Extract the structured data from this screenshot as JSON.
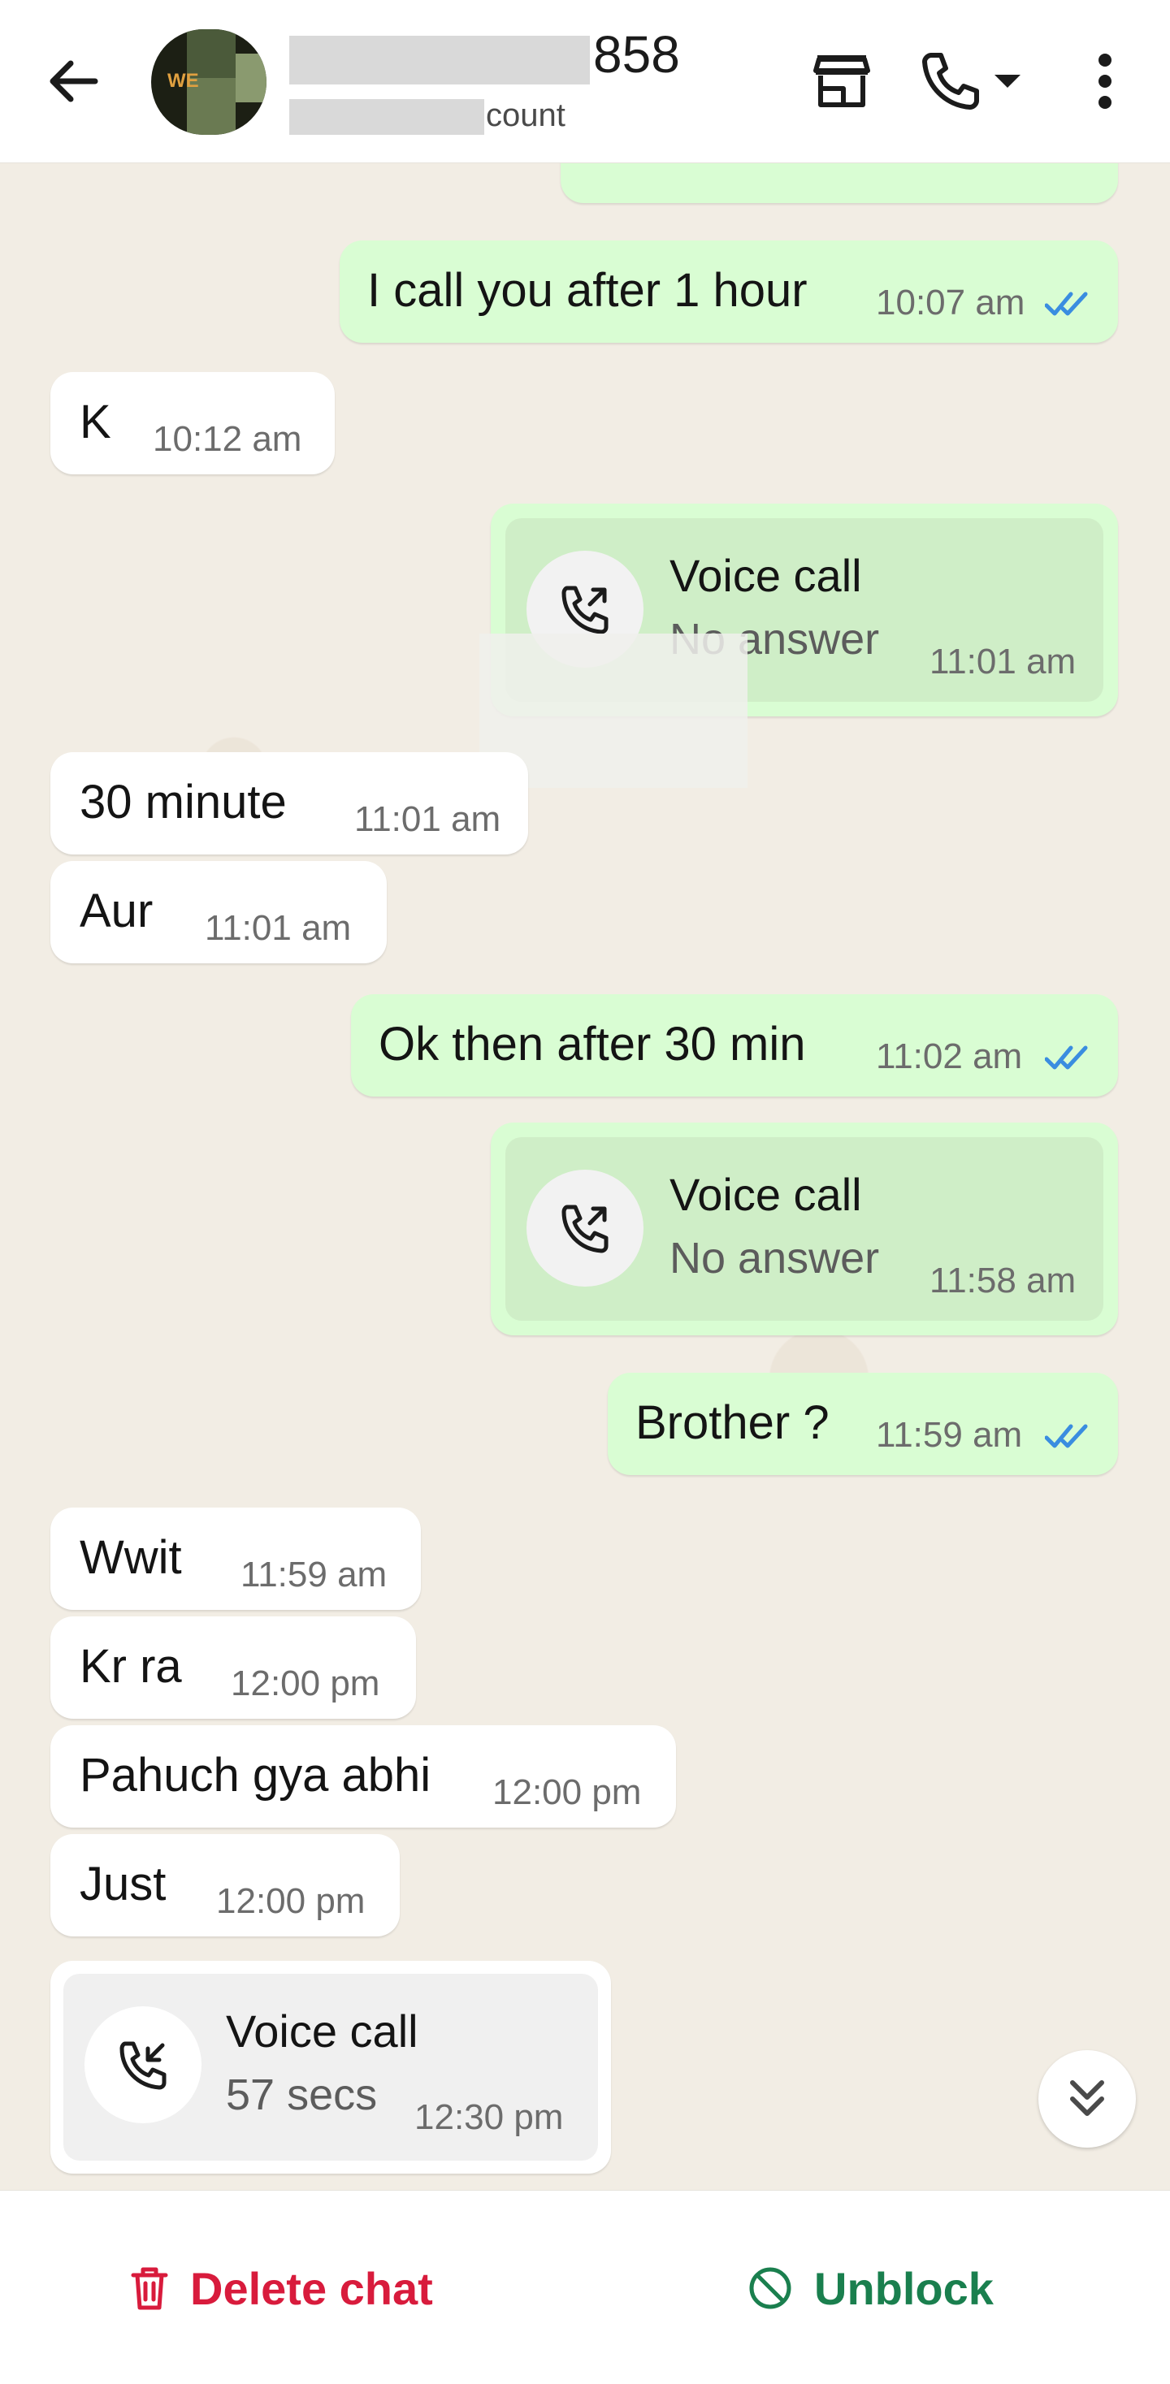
{
  "header": {
    "contact_name": "858",
    "contact_subtitle": "count",
    "icons": [
      "back-arrow-icon",
      "avatar",
      "store-icon",
      "phone-icon",
      "dropdown-caret-icon",
      "more-vert-icon"
    ]
  },
  "messages": [
    {
      "dir": "out",
      "text": "I call you after 1 hour",
      "time": "10:07 am",
      "read": true
    },
    {
      "dir": "in",
      "text": "K",
      "time": "10:12 am"
    },
    {
      "dir": "out",
      "type": "call",
      "title": "Voice call",
      "subtitle": "No answer",
      "time": "11:01 am"
    },
    {
      "dir": "in",
      "text": "30 minute",
      "time": "11:01 am"
    },
    {
      "dir": "in",
      "text": "Aur",
      "time": "11:01 am"
    },
    {
      "dir": "out",
      "text": "Ok then after 30 min",
      "time": "11:02 am",
      "read": true
    },
    {
      "dir": "out",
      "type": "call",
      "title": "Voice call",
      "subtitle": "No answer",
      "time": "11:58 am"
    },
    {
      "dir": "out",
      "text": "Brother ?",
      "time": "11:59 am",
      "read": true
    },
    {
      "dir": "in",
      "text": "Wwit",
      "time": "11:59 am"
    },
    {
      "dir": "in",
      "text": "Kr ra",
      "time": "12:00 pm"
    },
    {
      "dir": "in",
      "text": "Pahuch gya abhi",
      "time": "12:00 pm"
    },
    {
      "dir": "in",
      "text": "Just",
      "time": "12:00 pm"
    },
    {
      "dir": "in",
      "type": "call",
      "title": "Voice call",
      "subtitle": "57 secs",
      "time": "12:30 pm"
    }
  ],
  "bottom": {
    "delete_label": "Delete chat",
    "unblock_label": "Unblock"
  },
  "colors": {
    "outgoing_bubble": "#d9fdd3",
    "incoming_bubble": "#ffffff",
    "chat_background": "#f2ede4",
    "read_ticks": "#3a8de0",
    "delete_red": "#d81b3c",
    "unblock_green": "#1a7f4e"
  }
}
